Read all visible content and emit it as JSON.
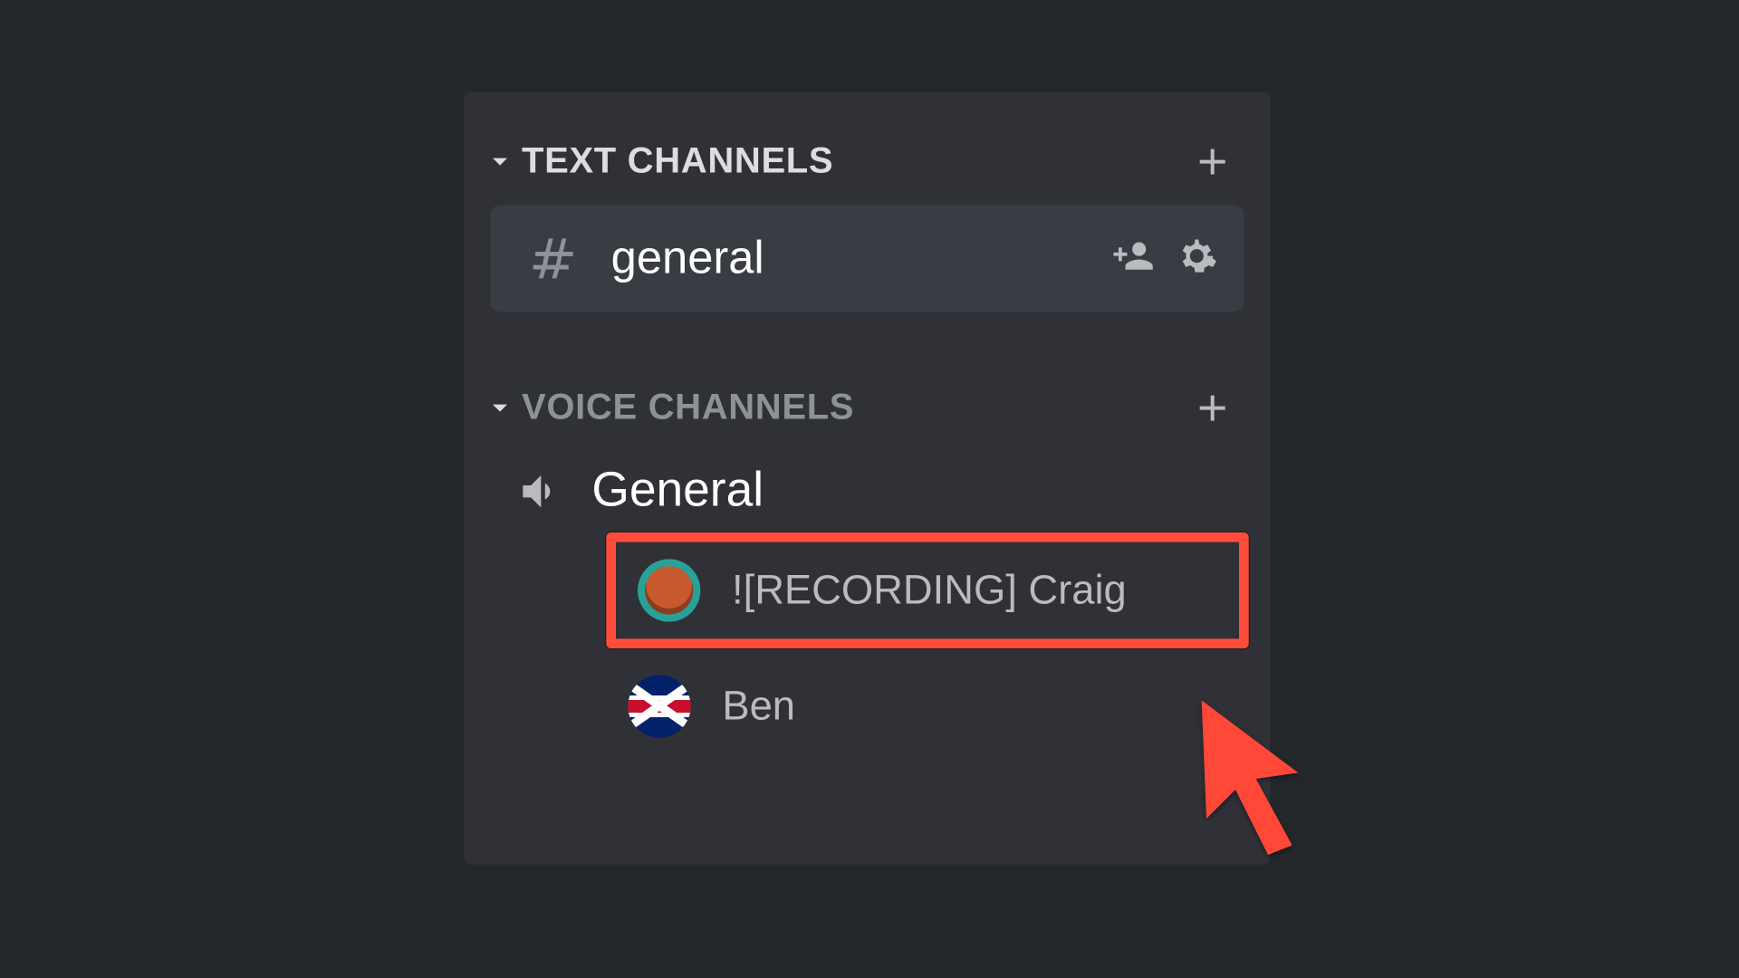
{
  "text_channels": {
    "header": "TEXT CHANNELS",
    "items": [
      {
        "name": "general"
      }
    ]
  },
  "voice_channels": {
    "header": "VOICE CHANNELS",
    "items": [
      {
        "name": "General",
        "participants": [
          {
            "name": "![RECORDING] Craig",
            "avatar": "craig",
            "highlighted": true
          },
          {
            "name": "Ben",
            "avatar": "ben",
            "highlighted": false
          }
        ]
      }
    ]
  },
  "accent_highlight": "#FF4C3B"
}
